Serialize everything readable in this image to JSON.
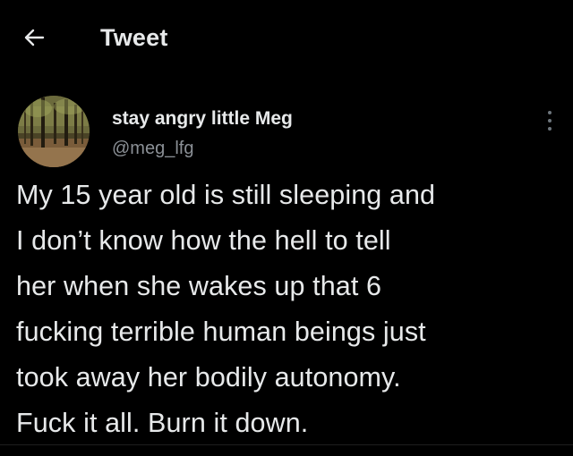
{
  "header": {
    "back_icon": "arrow-left-icon",
    "title": "Tweet"
  },
  "tweet": {
    "author": {
      "display_name": "stay angry little Meg",
      "handle": "@meg_lfg",
      "avatar_icon": "forest-photo-avatar"
    },
    "more_icon": "more-vertical-icon",
    "text": "My 15 year old is still sleeping and\nI don’t know how the hell to tell\nher when she wakes up that 6\nfucking terrible human beings just\ntook away her bodily autonomy.\nFuck it all. Burn it down."
  },
  "colors": {
    "background": "#000000",
    "primary_text": "#e7e9ea",
    "secondary_text": "#8b9096"
  }
}
